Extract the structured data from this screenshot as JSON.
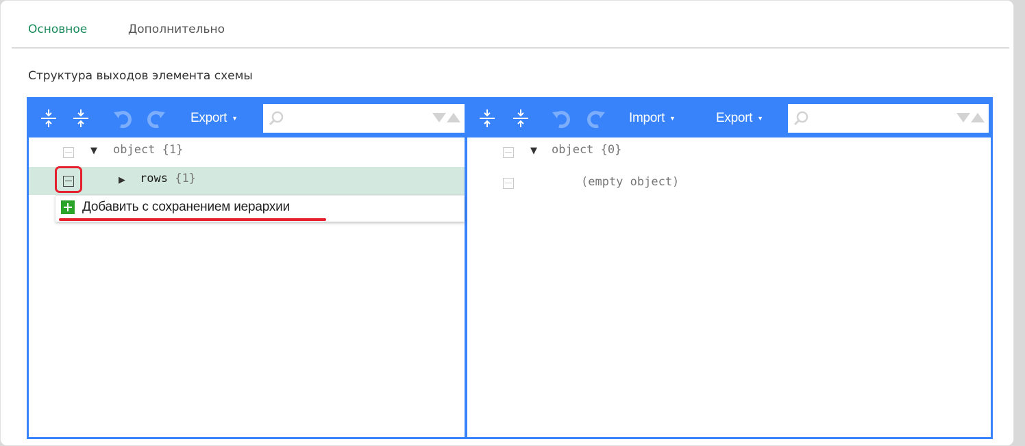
{
  "tabs": [
    {
      "label": "Основное",
      "active": true
    },
    {
      "label": "Дополнительно",
      "active": false
    }
  ],
  "section_title": "Структура выходов элемента схемы",
  "colors": {
    "toolbar": "#3883fa",
    "active_tab": "#1a8a5b",
    "selected_row": "#d3e8df",
    "highlight": "#e5202f",
    "add_icon": "#2aa52a"
  },
  "left_editor": {
    "toolbar": {
      "icons": [
        "expand-all-icon",
        "collapse-all-icon",
        "undo-icon",
        "redo-icon",
        "search-icon"
      ],
      "export_label": "Export",
      "search_placeholder": ""
    },
    "tree": [
      {
        "key": "object",
        "count": "{1}",
        "expanded": true
      },
      {
        "key": "rows",
        "count": "{1}",
        "expanded": false,
        "selected": true
      }
    ]
  },
  "right_editor": {
    "toolbar": {
      "icons": [
        "expand-all-icon",
        "collapse-all-icon",
        "undo-icon",
        "redo-icon",
        "search-icon"
      ],
      "import_label": "Import",
      "export_label": "Export",
      "search_placeholder": ""
    },
    "tree": [
      {
        "key": "object",
        "count": "{0}",
        "expanded": true
      },
      {
        "text": "(empty object)"
      }
    ]
  },
  "context_menu": {
    "items": [
      {
        "label": "Добавить с сохранением иерархии",
        "icon": "plus-icon"
      }
    ]
  }
}
